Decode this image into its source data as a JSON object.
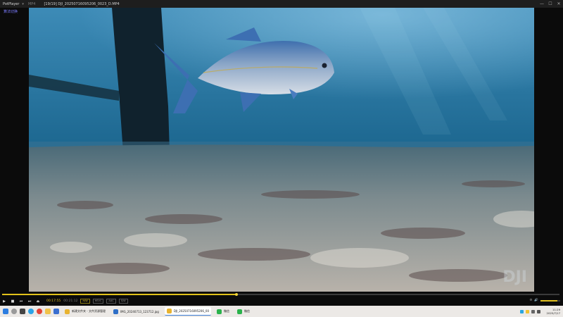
{
  "titlebar": {
    "app_name": "PotPlayer",
    "menu": "MP4",
    "filename": "[19/19] DJI_20250716095206_0023_D.MP4",
    "min": "—",
    "max": "☐",
    "close": "✕"
  },
  "subtitle_tag": "算法切换",
  "watermark": "DJI",
  "player": {
    "current_time": "00:17:55",
    "total_time": "00:21:12",
    "progress": 0.42,
    "volume": 0.85,
    "chips": [
      "H/W",
      "HEVC",
      "AAC",
      "S/W"
    ]
  },
  "taskbar": {
    "apps": [
      {
        "label": "新建文件夹 - 文件资源管理",
        "color": "#e8b330"
      },
      {
        "label": "IMG_20240713_123712.jpg",
        "color": "#2f6fc7"
      },
      {
        "label": "DJI_20250716095206_00",
        "color": "#e8b330",
        "active": true
      },
      {
        "label": "微信",
        "color": "#2bb24c"
      },
      {
        "label": "微信",
        "color": "#2bb24c"
      }
    ],
    "clock_time": "11:29",
    "clock_date": "2025/7/17"
  },
  "colors": {
    "accent": "#e2c21a",
    "water_top": "#3d8bb7",
    "water_bottom": "#0f4f75"
  }
}
